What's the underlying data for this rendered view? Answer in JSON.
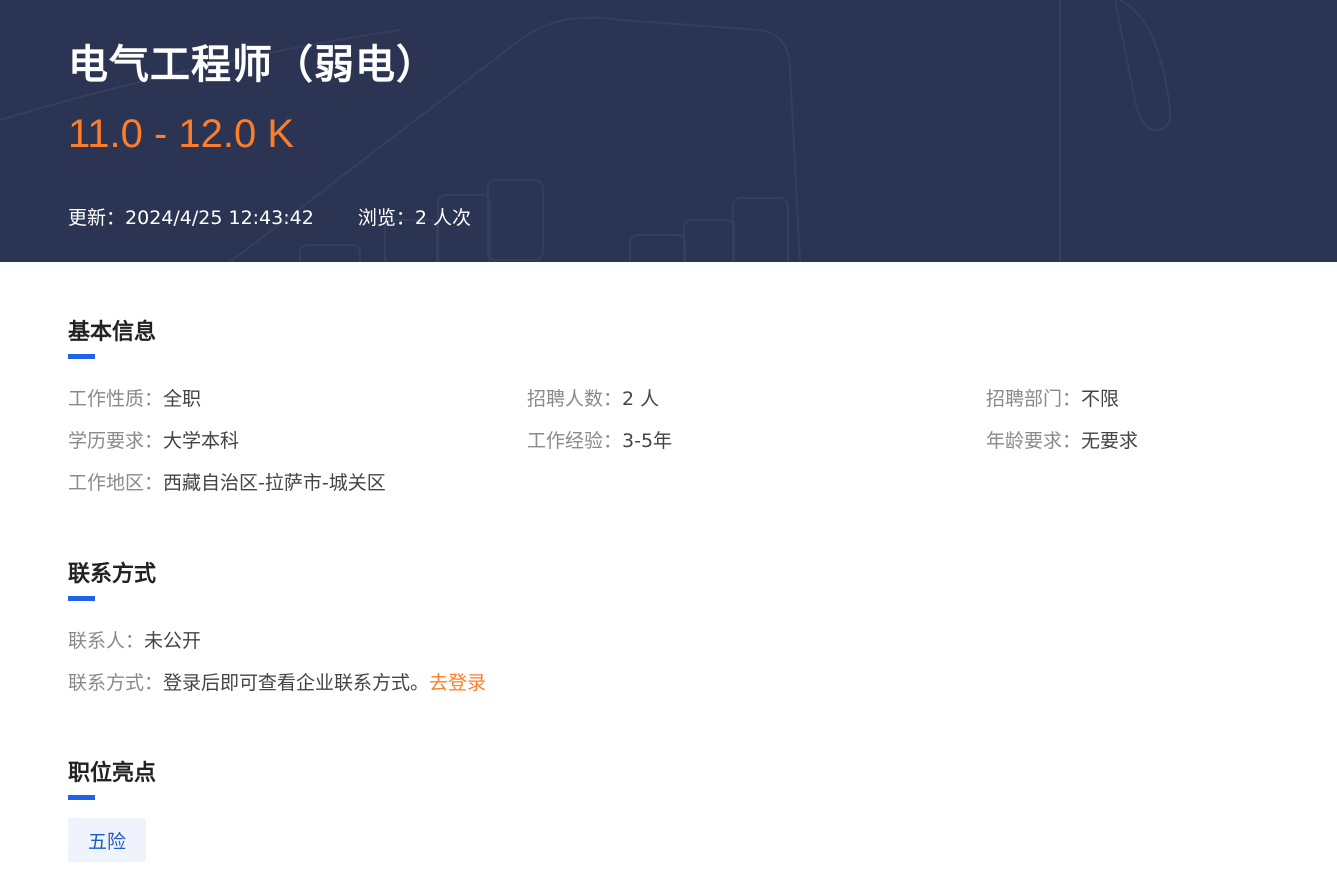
{
  "header": {
    "title": "电气工程师（弱电）",
    "salary": "11.0 - 12.0 K",
    "updated_label": "更新：",
    "updated_value": "2024/4/25 12:43:42",
    "views_label": "浏览：",
    "views_value": "2 人次"
  },
  "basic_info": {
    "title": "基本信息",
    "fields": [
      {
        "label": "工作性质：",
        "value": "全职"
      },
      {
        "label": "招聘人数：",
        "value": "2 人"
      },
      {
        "label": "招聘部门：",
        "value": "不限"
      },
      {
        "label": "学历要求：",
        "value": "大学本科"
      },
      {
        "label": "工作经验：",
        "value": "3-5年"
      },
      {
        "label": "年龄要求：",
        "value": "无要求"
      },
      {
        "label": "工作地区：",
        "value": "西藏自治区-拉萨市-城关区"
      }
    ]
  },
  "contact": {
    "title": "联系方式",
    "person_label": "联系人：",
    "person_value": "未公开",
    "method_label": "联系方式：",
    "method_value": "登录后即可查看企业联系方式。",
    "login_link": "去登录"
  },
  "highlights": {
    "title": "职位亮点",
    "tags": [
      "五险"
    ]
  },
  "colors": {
    "header_bg": "#2c3553",
    "salary": "#ff7d28",
    "accent_bar": "#1f63e8",
    "link": "#ff7d28",
    "tag_bg": "#eff3fb",
    "tag_text": "#1f5bc9"
  }
}
